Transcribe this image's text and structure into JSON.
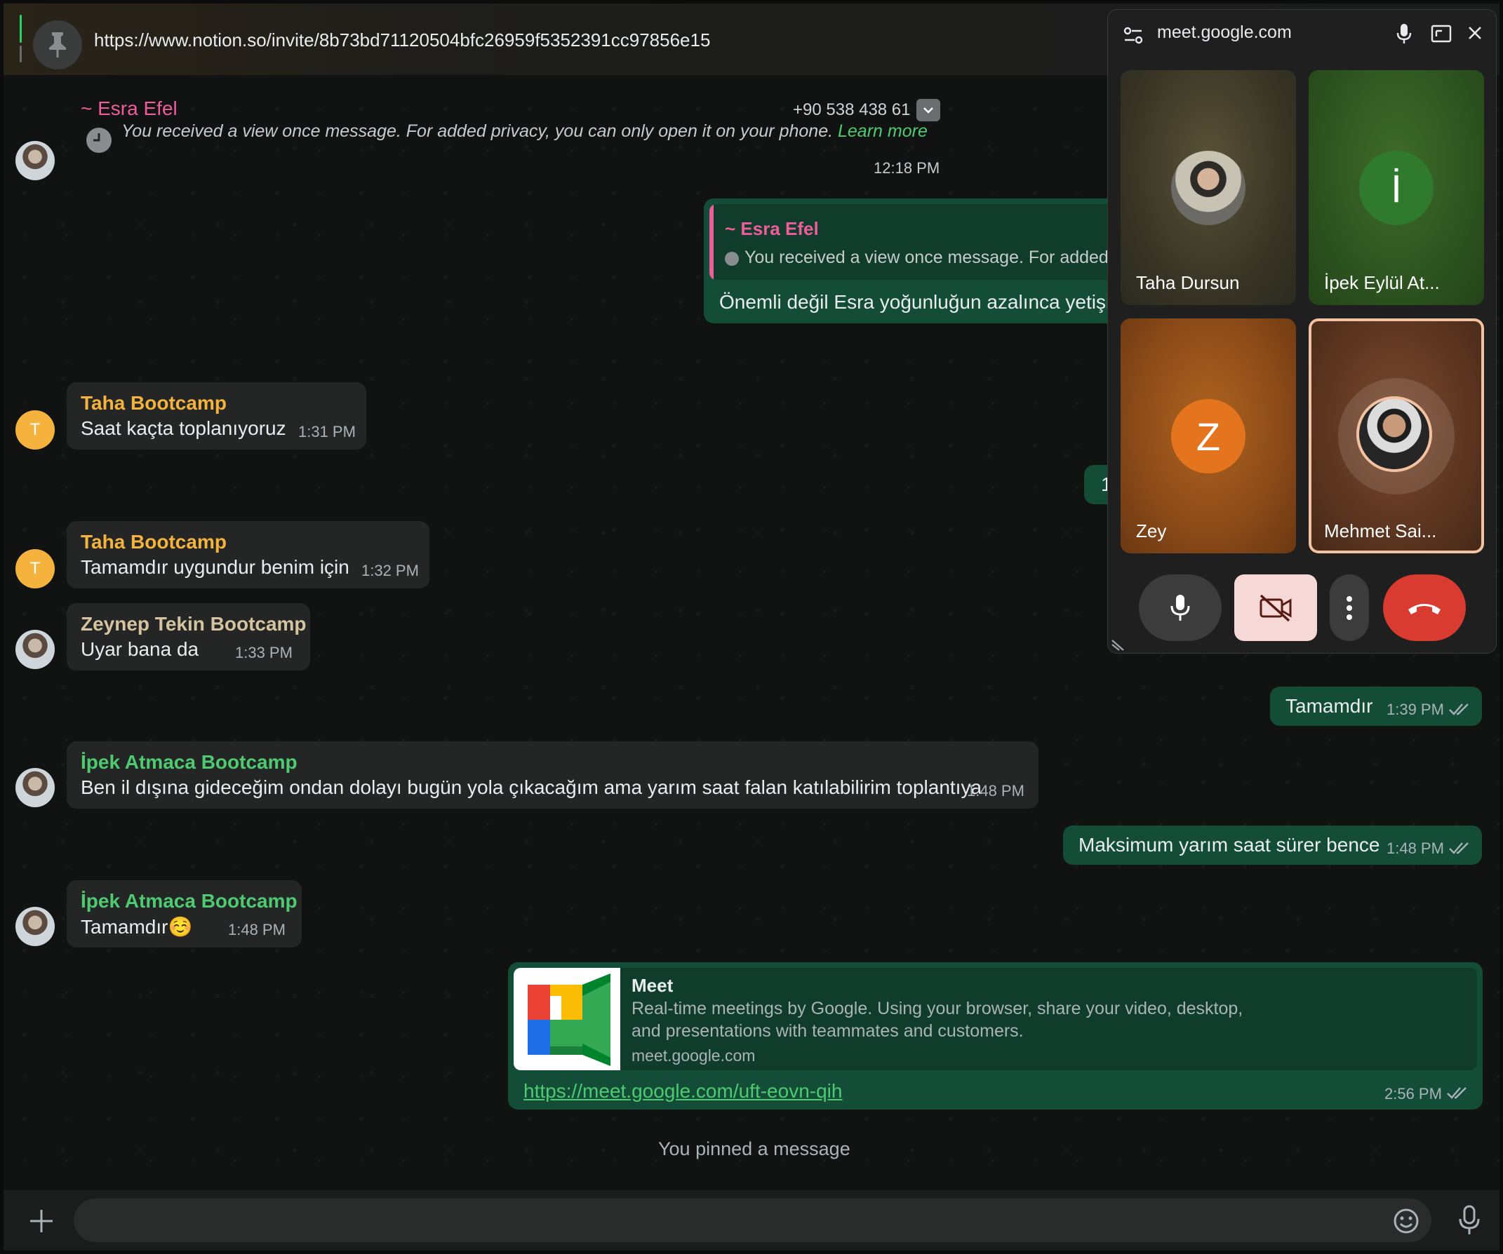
{
  "pinned": {
    "url": "https://www.notion.so/invite/8b73bd71120504bfc26959f5352391cc97856e15"
  },
  "messages": {
    "esra": {
      "sender": "~ Esra Efel",
      "phone": "+90 538 438 61",
      "text": "You received a view once message. For added privacy, you can only open it on your phone.",
      "learn_more": "Learn more",
      "time": "12:18 PM"
    },
    "reply": {
      "quoted_sender": "~ Esra Efel",
      "quoted_text": "You received a view once message. For added privacy, you can only open it on your phone.",
      "text": "Önemli değil Esra yoğunluğun azalınca yetişirsin"
    },
    "taha1": {
      "sender": "Taha Bootcamp",
      "text": "Saat kaçta toplanıyoruz",
      "time": "1:31 PM",
      "avatar_letter": "T"
    },
    "hidden_out": {
      "text": "1"
    },
    "taha2": {
      "sender": "Taha Bootcamp",
      "text": "Tamamdır uygundur benim için",
      "time": "1:32 PM",
      "avatar_letter": "T"
    },
    "zeynep": {
      "sender": "Zeynep Tekin Bootcamp",
      "text": "Uyar bana da",
      "time": "1:33 PM"
    },
    "out1": {
      "text": "Tamamdır",
      "time": "1:39 PM"
    },
    "ipek1": {
      "sender": "İpek Atmaca Bootcamp",
      "text": "Ben il dışına gideceğim ondan dolayı bugün yola çıkacağım ama yarım saat falan katılabilirim toplantıya",
      "time": "1:48 PM"
    },
    "out2": {
      "text": "Maksimum yarım saat sürer bence",
      "time": "1:48 PM"
    },
    "ipek2": {
      "sender": "İpek Atmaca Bootcamp",
      "text": "Tamamdır☺️",
      "time": "1:48 PM"
    },
    "link": {
      "title": "Meet",
      "desc1": "Real-time meetings by Google. Using your browser, share your video, desktop,",
      "desc2": "and presentations with teammates and customers.",
      "domain": "meet.google.com",
      "url": "https://meet.google.com/uft-eovn-qih",
      "time": "2:56 PM"
    },
    "system": "You pinned a message"
  },
  "meet": {
    "domain": "meet.google.com",
    "tiles": [
      {
        "name": "Taha Dursun"
      },
      {
        "name": "İpek Eylül At...",
        "letter": "İ"
      },
      {
        "name": "Zey",
        "letter": "Z"
      },
      {
        "name": "Mehmet Sai..."
      }
    ]
  },
  "colors": {
    "outgoing": "#144d37",
    "incoming": "#242626",
    "accent_green": "#25d366",
    "esra": "#f15c9b",
    "taha": "#f5b33d",
    "ipek": "#4ecb71",
    "zeynep": "#d6c3a0",
    "end_call": "#d93b30"
  }
}
